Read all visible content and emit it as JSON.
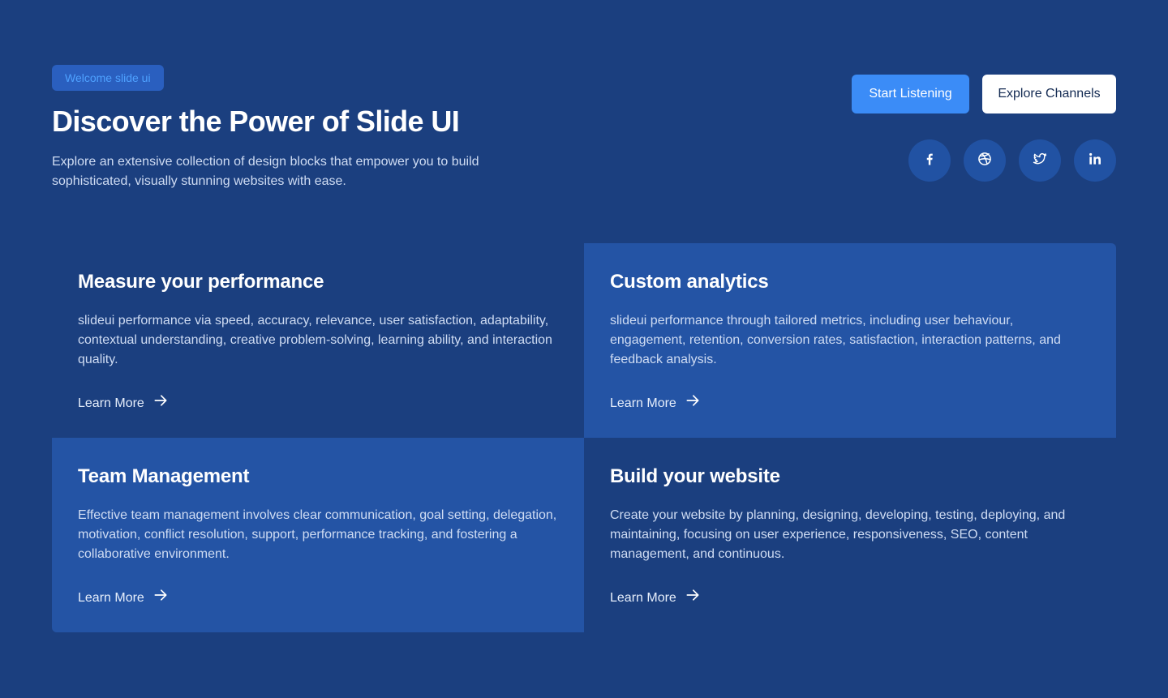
{
  "header": {
    "badge": "Welcome slide ui",
    "title": "Discover the Power of Slide UI",
    "subtitle": "Explore an extensive collection of design blocks that empower you to build sophisticated, visually stunning websites with ease."
  },
  "actions": {
    "primary_label": "Start Listening",
    "secondary_label": "Explore Channels"
  },
  "social": [
    "facebook-icon",
    "dribbble-icon",
    "twitter-icon",
    "linkedin-icon"
  ],
  "features": [
    {
      "title": "Measure your performance",
      "description": "slideui performance via speed, accuracy, relevance, user satisfaction, adaptability, contextual understanding, creative problem-solving, learning ability, and interaction quality.",
      "link": "Learn More"
    },
    {
      "title": "Custom analytics",
      "description": "slideui performance through tailored metrics, including user behaviour, engagement, retention, conversion rates, satisfaction, interaction patterns, and feedback analysis.",
      "link": "Learn More"
    },
    {
      "title": "Team Management",
      "description": "Effective team management involves clear communication, goal setting, delegation, motivation, conflict resolution, support, performance tracking, and fostering a collaborative environment.",
      "link": "Learn More"
    },
    {
      "title": "Build your website",
      "description": "Create your website by planning, designing, developing, testing, deploying, and maintaining, focusing on user experience, responsiveness, SEO, content management, and continuous.",
      "link": "Learn More"
    }
  ],
  "colors": {
    "background": "#1b3f7f",
    "card_alt": "#2454a5",
    "primary": "#3b8cf7",
    "badge_bg": "#2a5fbf",
    "badge_text": "#4ea1ff"
  }
}
